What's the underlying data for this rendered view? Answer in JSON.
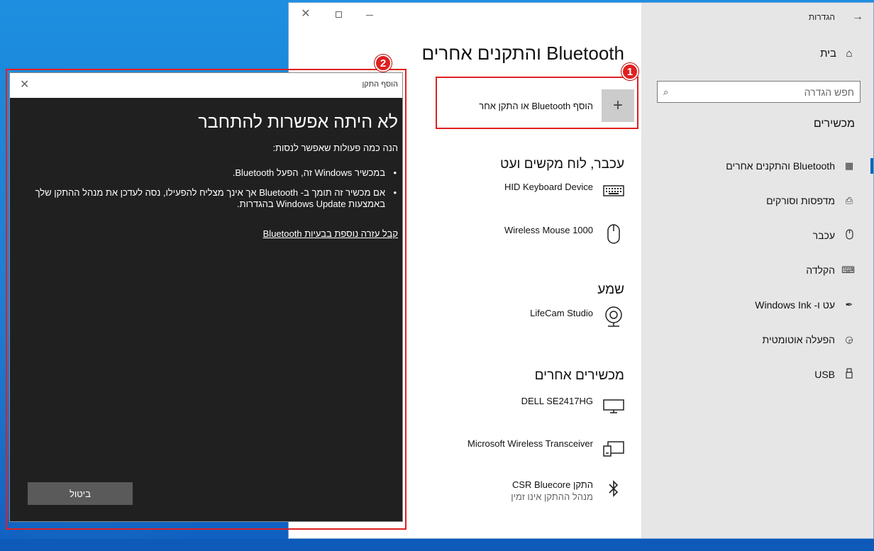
{
  "settings_window": {
    "app_title": "הגדרות",
    "sidebar": {
      "home_label": "בית",
      "search_placeholder": "חפש הגדרה",
      "section_title": "מכשירים",
      "items": [
        {
          "label": "Bluetooth והתקנים אחרים",
          "icon": "bluetooth-devices-icon"
        },
        {
          "label": "מדפסות וסורקים",
          "icon": "printer-icon"
        },
        {
          "label": "עכבר",
          "icon": "mouse-icon"
        },
        {
          "label": "הקלדה",
          "icon": "keyboard-icon"
        },
        {
          "label": "עט ו- Windows Ink",
          "icon": "pen-icon"
        },
        {
          "label": "הפעלה אוטומטית",
          "icon": "autoplay-icon"
        },
        {
          "label": "USB",
          "icon": "usb-icon"
        }
      ]
    },
    "main": {
      "page_title": "Bluetooth והתקנים אחרים",
      "add_button_label": "הוסף Bluetooth או התקן אחר",
      "categories": {
        "input": {
          "title": "עכבר, לוח מקשים ועט",
          "devices": [
            "HID Keyboard Device",
            "Wireless Mouse 1000"
          ]
        },
        "audio": {
          "title": "שמע",
          "devices": [
            "LifeCam Studio"
          ]
        },
        "other": {
          "title": "מכשירים אחרים",
          "devices": [
            "DELL SE2417HG",
            "Microsoft Wireless Transceiver"
          ],
          "bt_device": {
            "name": "התקן CSR Bluecore",
            "status": "מנהל ההתקן אינו זמין"
          }
        }
      }
    }
  },
  "dialog": {
    "title": "הוסף התקן",
    "heading": "לא היתה אפשרות להתחבר",
    "intro": "הנה כמה פעולות שאפשר לנסות:",
    "tips": [
      "במכשיר Windows זה, הפעל Bluetooth.",
      "אם מכשיר זה תומך ב- Bluetooth אך אינך מצליח להפעילו, נסה לעדכן את מנהל ההתקן שלך באמצעות Windows Update בהגדרות."
    ],
    "help_link": "קבל עזרה נוספת בבעיות Bluetooth",
    "cancel_label": "ביטול"
  },
  "annotations": {
    "marker_1": "1",
    "marker_2": "2",
    "color": "#e02020"
  },
  "colors": {
    "accent": "#0067c0",
    "sidebar_bg": "#e6e6e6",
    "dialog_bg": "#202020"
  }
}
